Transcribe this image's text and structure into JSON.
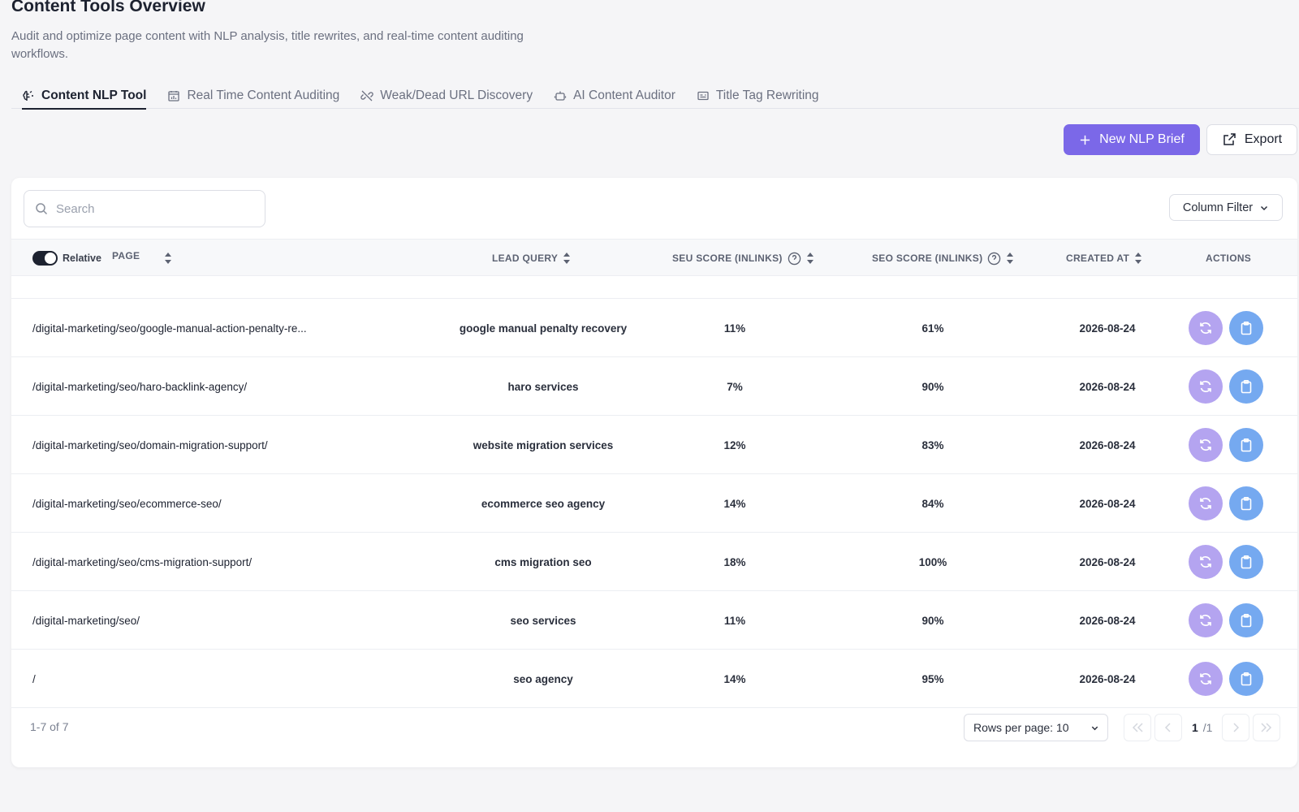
{
  "header": {
    "title": "Content Tools Overview",
    "subtitle": "Audit and optimize page content with NLP analysis, title rewrites, and real-time content auditing workflows."
  },
  "tabs": [
    {
      "label": "Content NLP Tool",
      "icon": "brain-icon",
      "active": true
    },
    {
      "label": "Real Time Content Auditing",
      "icon": "calendar-chart-icon",
      "active": false
    },
    {
      "label": "Weak/Dead URL Discovery",
      "icon": "broken-link-icon",
      "active": false
    },
    {
      "label": "AI Content Auditor",
      "icon": "robot-icon",
      "active": false
    },
    {
      "label": "Title Tag Rewriting",
      "icon": "tag-card-icon",
      "active": false
    }
  ],
  "toolbar": {
    "new_label": "New NLP Brief",
    "export_label": "Export"
  },
  "table": {
    "search_placeholder": "Search",
    "column_filter_label": "Column Filter",
    "toggle_label": "Relative",
    "toggle_on": true,
    "headers": {
      "page": "PAGE",
      "lead_query": "LEAD QUERY",
      "seu_score": "SEU SCORE (INLINKS)",
      "seo_score": "SEO SCORE (INLINKS)",
      "created_at": "CREATED AT",
      "actions": "ACTIONS"
    },
    "rows": [
      {
        "page": "/digital-marketing/seo/google-manual-action-penalty-re...",
        "query": "google manual penalty recovery",
        "seu": "11%",
        "seo": "61%",
        "created": "2026-08-24"
      },
      {
        "page": "/digital-marketing/seo/haro-backlink-agency/",
        "query": "haro services",
        "seu": "7%",
        "seo": "90%",
        "created": "2026-08-24"
      },
      {
        "page": "/digital-marketing/seo/domain-migration-support/",
        "query": "website migration services",
        "seu": "12%",
        "seo": "83%",
        "created": "2026-08-24"
      },
      {
        "page": "/digital-marketing/seo/ecommerce-seo/",
        "query": "ecommerce seo agency",
        "seu": "14%",
        "seo": "84%",
        "created": "2026-08-24"
      },
      {
        "page": "/digital-marketing/seo/cms-migration-support/",
        "query": "cms migration seo",
        "seu": "18%",
        "seo": "100%",
        "created": "2026-08-24"
      },
      {
        "page": "/digital-marketing/seo/",
        "query": "seo services",
        "seu": "11%",
        "seo": "90%",
        "created": "2026-08-24"
      },
      {
        "page": "/",
        "query": "seo agency",
        "seu": "14%",
        "seo": "95%",
        "created": "2026-08-24"
      }
    ],
    "footer": {
      "count": "1-7 of 7",
      "rows_per_page": "Rows per page: 10",
      "page_current": "1",
      "page_total": "/1"
    }
  },
  "colors": {
    "primary": "#7b68e8",
    "refresh_action": "#b4a4f0",
    "clipboard_action": "#75a9f0"
  }
}
